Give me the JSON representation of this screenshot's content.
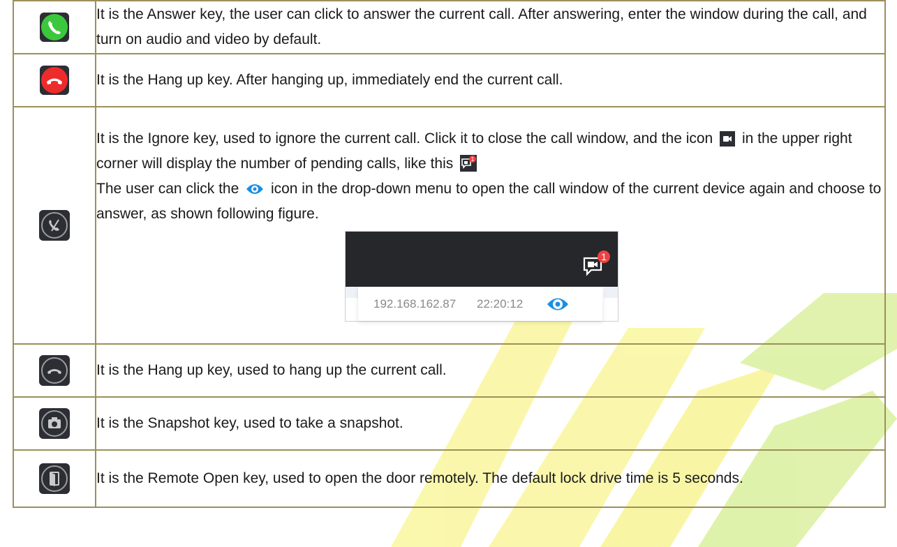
{
  "rows": [
    {
      "icon": "phone-answer-icon",
      "text": "It is the Answer key, the user can click to answer the current call. After answering, enter the window during the call, and turn on audio and video by default."
    },
    {
      "icon": "phone-hangup-red-icon",
      "text": "It is the Hang up key. After hanging up, immediately end the current call."
    },
    {
      "icon": "ignore-call-icon",
      "line1_pre": "It is the Ignore key, used to ignore the current call. Click it to close the call window, and the icon",
      "line1_post": "in the upper right corner will display the number of pending calls, like this",
      "line2_pre": "The user can click the",
      "line2_post": "icon in the drop-down menu to open the call window of the current device again and choose to answer, as shown following figure.",
      "figure": {
        "badge_count": "1",
        "ip": "192.168.162.87",
        "time": "22:20:12"
      }
    },
    {
      "icon": "hangup-dark-icon",
      "text": "It is the Hang up key, used to hang up the current call."
    },
    {
      "icon": "snapshot-camera-icon",
      "text": "It is the Snapshot key, used to take a snapshot."
    },
    {
      "icon": "remote-open-door-icon",
      "text": "It is the Remote Open key, used to open the door remotely. The default lock drive time is 5 seconds."
    }
  ],
  "colors": {
    "answer_green": "#3cc83c",
    "hangup_red": "#ee2b2b",
    "dark_button": "#2b2d31",
    "eye_blue": "#1a8fe6",
    "badge_red": "#f04141",
    "watermark_yellow": "#f3f04a",
    "watermark_green": "#b9e35a"
  }
}
